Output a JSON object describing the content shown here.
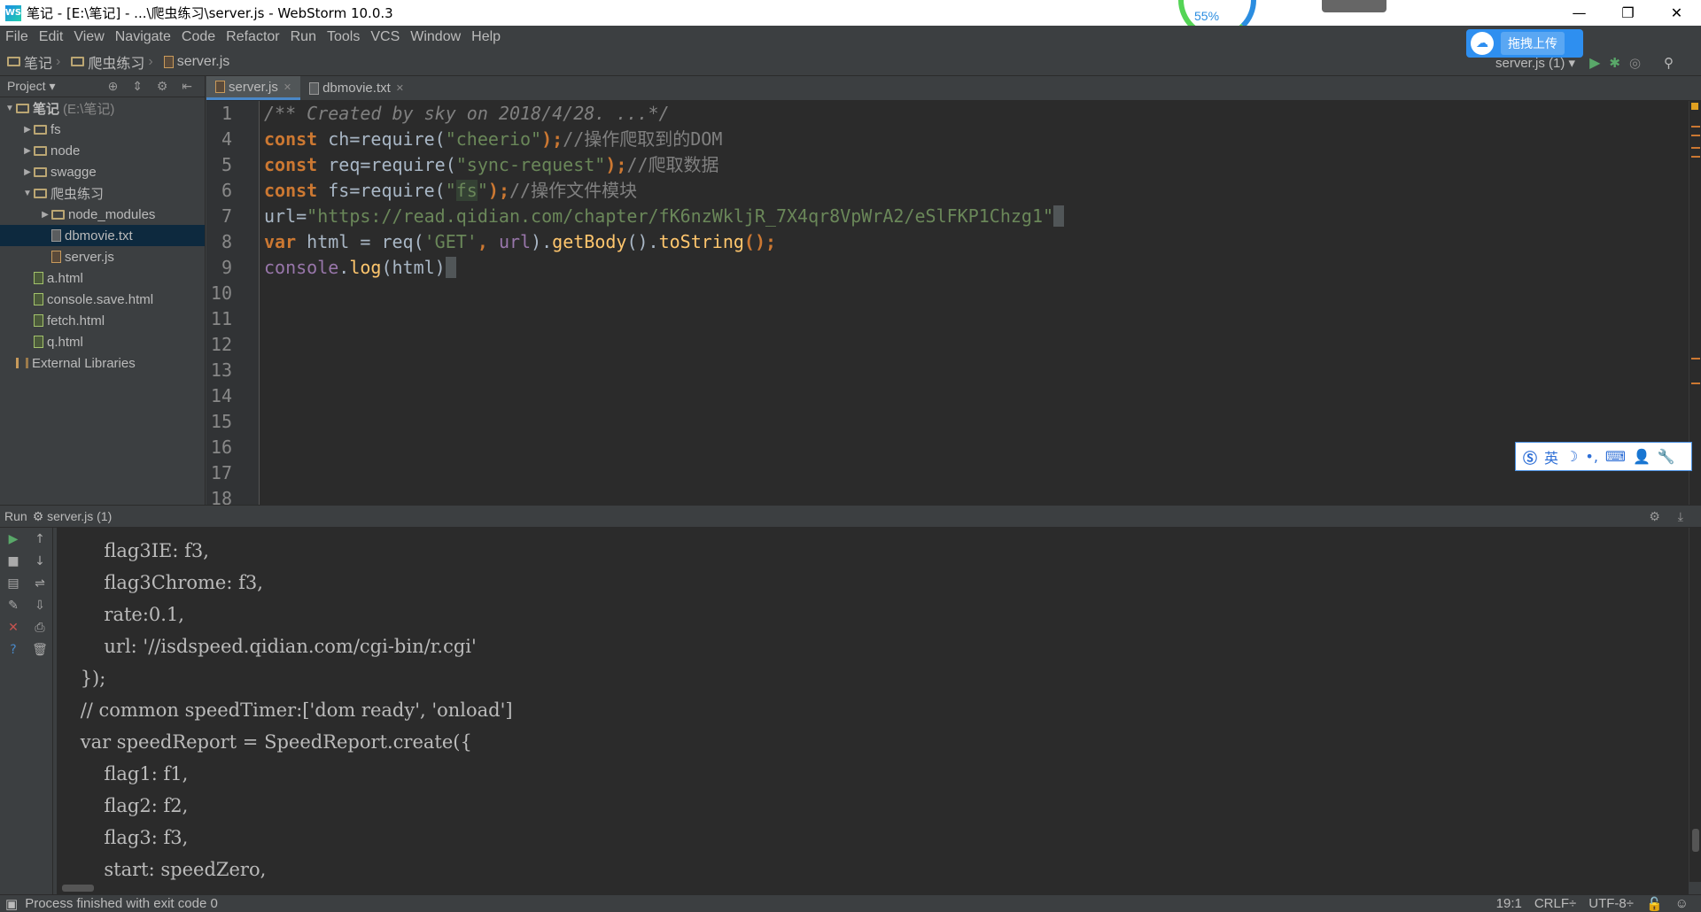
{
  "window": {
    "title": "笔记 - [E:\\笔记] - ...\\爬虫练习\\server.js - WebStorm 10.0.3",
    "speed_percent": "55%",
    "minimize": "—",
    "restore": "❐",
    "close": "✕"
  },
  "menu": [
    "File",
    "Edit",
    "View",
    "Navigate",
    "Code",
    "Refactor",
    "Run",
    "Tools",
    "VCS",
    "Window",
    "Help"
  ],
  "breadcrumbs": [
    "笔记",
    "爬虫练习",
    "server.js"
  ],
  "upload": {
    "label": "拖拽上传"
  },
  "run_config": {
    "label": "server.js (1)"
  },
  "project_panel": {
    "title": "Project",
    "tree": [
      {
        "label": "笔记",
        "suffix": "(E:\\笔记)",
        "depth": 0,
        "kind": "folder",
        "expanded": true
      },
      {
        "label": "fs",
        "depth": 1,
        "kind": "folder",
        "expanded": false
      },
      {
        "label": "node",
        "depth": 1,
        "kind": "folder",
        "expanded": false
      },
      {
        "label": "swagge",
        "depth": 1,
        "kind": "folder",
        "expanded": false
      },
      {
        "label": "爬虫练习",
        "depth": 1,
        "kind": "folder",
        "expanded": true
      },
      {
        "label": "node_modules",
        "depth": 2,
        "kind": "folder",
        "expanded": false
      },
      {
        "label": "dbmovie.txt",
        "depth": 2,
        "kind": "txt",
        "selected": true
      },
      {
        "label": "server.js",
        "depth": 2,
        "kind": "js"
      },
      {
        "label": "a.html",
        "depth": 1,
        "kind": "html"
      },
      {
        "label": "console.save.html",
        "depth": 1,
        "kind": "html"
      },
      {
        "label": "fetch.html",
        "depth": 1,
        "kind": "html"
      },
      {
        "label": "q.html",
        "depth": 1,
        "kind": "html"
      },
      {
        "label": "External Libraries",
        "depth": 0,
        "kind": "lib"
      }
    ]
  },
  "tabs": [
    {
      "label": "server.js",
      "active": true
    },
    {
      "label": "dbmovie.txt",
      "active": false
    }
  ],
  "editor": {
    "line_numbers": [
      "1",
      "4",
      "5",
      "6",
      "7",
      "8",
      "9",
      "10",
      "11",
      "12",
      "13",
      "14",
      "15",
      "16",
      "17",
      "18"
    ],
    "lines": [
      {
        "parts": [
          {
            "t": "/** Created by sky on 2018/4/28. ...*/",
            "c": "c-comment"
          }
        ]
      },
      {
        "parts": [
          {
            "t": "const",
            "c": "c-kw"
          },
          {
            "t": " ch=require(",
            "c": ""
          },
          {
            "t": "\"cheerio\"",
            "c": "c-str"
          },
          {
            "t": ");",
            "c": "c-kw"
          },
          {
            "t": "//操作爬取到的DOM",
            "c": "c-cm"
          }
        ]
      },
      {
        "parts": [
          {
            "t": "const",
            "c": "c-kw"
          },
          {
            "t": " req=require(",
            "c": ""
          },
          {
            "t": "\"sync-request\"",
            "c": "c-str"
          },
          {
            "t": ");",
            "c": "c-kw"
          },
          {
            "t": "//爬取数据",
            "c": "c-cm"
          }
        ]
      },
      {
        "parts": [
          {
            "t": "const",
            "c": "c-kw"
          },
          {
            "t": " fs=require(",
            "c": ""
          },
          {
            "t": "\"",
            "c": "c-str"
          },
          {
            "t": "fs",
            "c": "c-str hl-bg"
          },
          {
            "t": "\"",
            "c": "c-str"
          },
          {
            "t": ");",
            "c": "c-kw"
          },
          {
            "t": "//操作文件模块",
            "c": "c-cm"
          }
        ]
      },
      {
        "parts": [
          {
            "t": "url=",
            "c": ""
          },
          {
            "t": "\"https://read.qidian.com/chapter/fK6nzWkljR_7X4qr8VpWrA2/eSlFKP1Chzg1\"",
            "c": "c-str"
          },
          {
            "t": " ",
            "c": "caret-box"
          }
        ]
      },
      {
        "parts": [
          {
            "t": "var",
            "c": "c-kw"
          },
          {
            "t": " html = req(",
            "c": ""
          },
          {
            "t": "'GET'",
            "c": "c-str"
          },
          {
            "t": ", ",
            "c": "c-kw"
          },
          {
            "t": "url",
            "c": "c-var"
          },
          {
            "t": ").",
            "c": ""
          },
          {
            "t": "getBody",
            "c": "c-fn"
          },
          {
            "t": "().",
            "c": ""
          },
          {
            "t": "toString",
            "c": "c-fn"
          },
          {
            "t": "();",
            "c": "c-kw"
          }
        ]
      },
      {
        "parts": [
          {
            "t": "console",
            "c": "c-var"
          },
          {
            "t": ".",
            "c": ""
          },
          {
            "t": "log",
            "c": "c-fn"
          },
          {
            "t": "(html)",
            "c": ""
          },
          {
            "t": " ",
            "c": "caret-box"
          }
        ]
      }
    ]
  },
  "ime": {
    "items": [
      "英",
      "☽",
      "•,",
      "⌨",
      "👤",
      "🔧"
    ]
  },
  "run_panel": {
    "title": "Run",
    "config": "server.js (1)",
    "console_lines": [
      "        flag3IE: f3,",
      "        flag3Chrome: f3,",
      "        rate:0.1,",
      "        url: '//isdspeed.qidian.com/cgi-bin/r.cgi'",
      "    });",
      "    // common speedTimer:['dom ready', 'onload']",
      "    var speedReport = SpeedReport.create({",
      "        flag1: f1,",
      "        flag2: f2,",
      "        flag3: f3,",
      "        start: speedZero,"
    ]
  },
  "status": {
    "message": "Process finished with exit code 0",
    "position": "19:1",
    "line_sep": "CRLF÷",
    "encoding": "UTF-8÷"
  }
}
